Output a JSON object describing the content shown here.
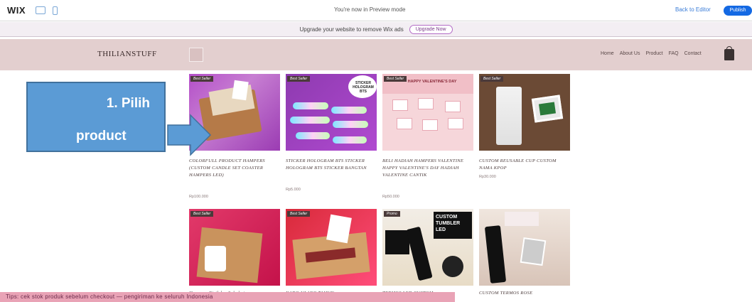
{
  "wix_bar": {
    "logo": "WIX",
    "preview_text": "You're now in Preview mode",
    "back_to_editor": "Back to Editor",
    "publish": "Publish"
  },
  "upgrade_banner": {
    "text": "Upgrade your website to remove Wix ads",
    "button": "Upgrade Now"
  },
  "site": {
    "logo": "THILIANSTUFF",
    "nav": [
      "Home",
      "About Us",
      "Product",
      "FAQ",
      "Contact"
    ]
  },
  "products": [
    {
      "ribbon": "Best Seller",
      "name": "COLORFULL PRODUCT HAMPERS (CUSTOM CANDLE SET COASTER HAMPERS LED)",
      "price": "Rp100.000"
    },
    {
      "ribbon": "Best Seller",
      "name": "STICKER HOLOGRAM BTS STICKER HOLOGRAM BTS STICKER BANGTAN",
      "price": "Rp5.000"
    },
    {
      "ribbon": "Best Seller",
      "name": "BELI HADIAH HAMPERS VALENTINE HAPPY VALENTINE'S DAY HADIAH VALENTINE CANTIK",
      "price": "Rp50.000"
    },
    {
      "ribbon": "Best Seller",
      "name": "CUSTOM REUSABLE CUP CUSTOM NAMA KPOP",
      "price": "Rp30.000"
    },
    {
      "ribbon": "Best Seller",
      "name": "Hampers Birthday Sahabat",
      "price": ""
    },
    {
      "ribbon": "Best Seller",
      "name": "KADO ULANG TAHUN",
      "price": ""
    },
    {
      "ribbon": "Promo",
      "name": "TERMOS LED CUSTOM",
      "price": ""
    },
    {
      "ribbon": "",
      "name": "CUSTOM TERMOS ROSE",
      "price": ""
    }
  ],
  "thumb_text": {
    "sticker_bubble": "STICKER HOLOGRAM BTS",
    "valentine_header": "HAPPY VALENTINE'S DAY",
    "custom_tumbler": "CUSTOM TUMBLER LED"
  },
  "callout": {
    "line1": "1. Pilih",
    "line2": "product"
  },
  "bottom_strip": "Tips: cek stok produk sebelum checkout — pengiriman ke seluruh Indonesia"
}
